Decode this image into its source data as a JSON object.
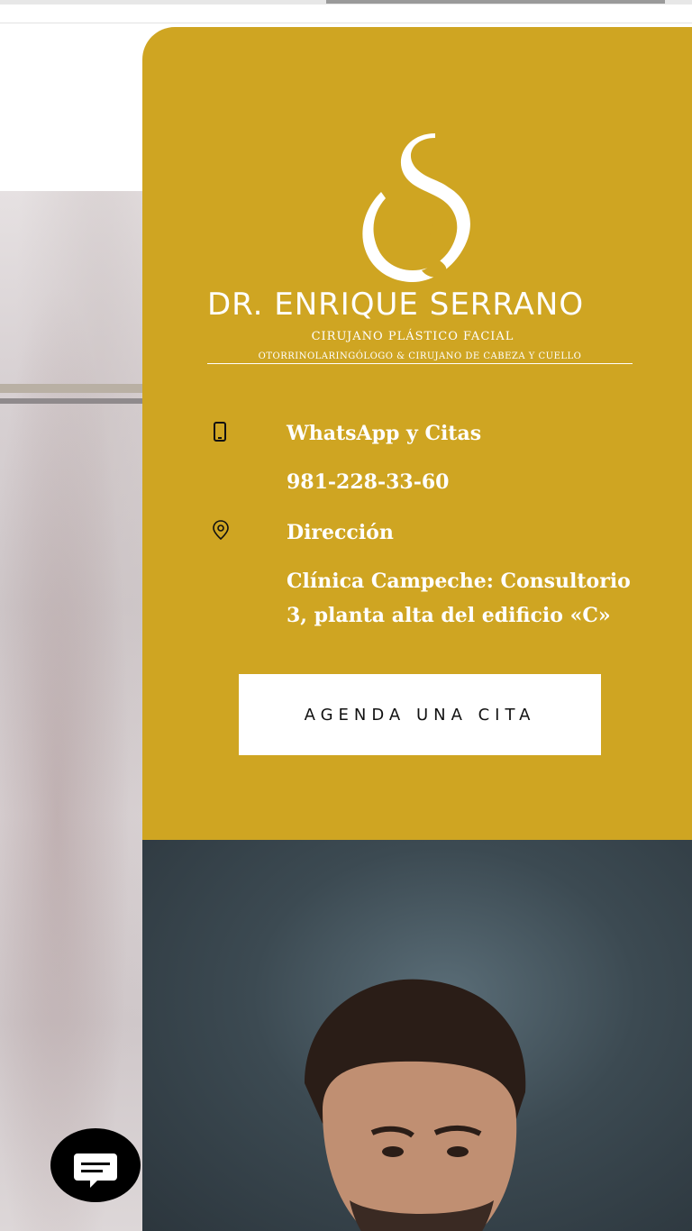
{
  "brand": {
    "name_prefix": "DR.",
    "name_first": "ENRIQUE",
    "name_last": "SERRANO",
    "tagline1": "CIRUJANO PLÁSTICO FACIAL",
    "tagline2": "OTORRINOLARINGÓLOGO & CIRUJANO DE CABEZA Y CUELLO"
  },
  "contact": {
    "whatsapp_label": "WhatsApp y Citas",
    "phone": "981-228-33-60",
    "address_label": "Dirección",
    "address_line1": "Clínica Campeche: Consultorio",
    "address_line2": "3, planta alta del edificio «C»"
  },
  "cta": {
    "label": "AGENDA UNA CITA"
  },
  "colors": {
    "accent": "#cfa522",
    "text_light": "#ffffff",
    "button_bg": "#ffffff"
  },
  "icons": {
    "phone": "mobile-phone-icon",
    "location": "location-pin-icon",
    "chat": "chat-bubble-icon"
  }
}
